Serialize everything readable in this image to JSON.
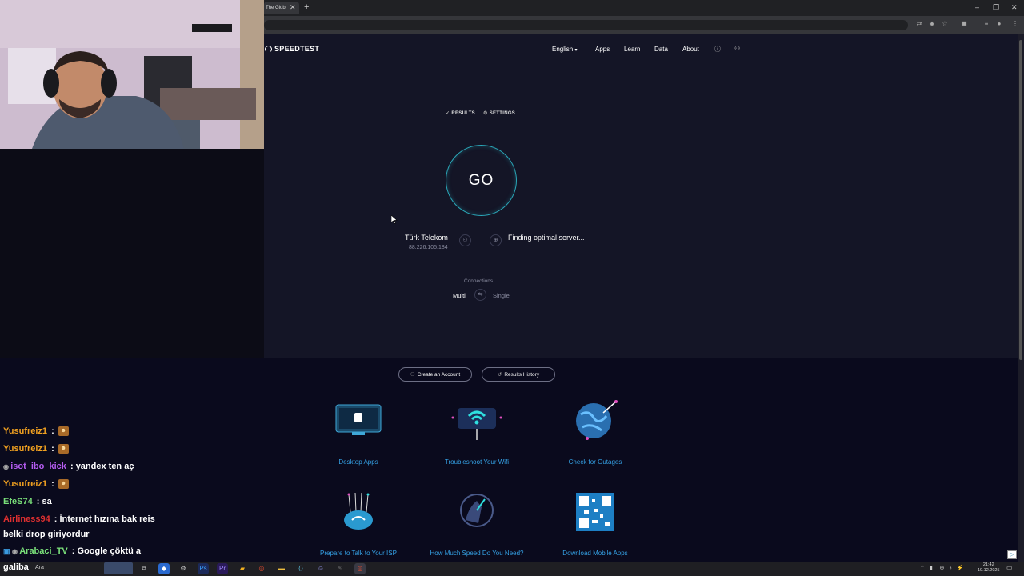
{
  "browser": {
    "tab_title": "The Glob",
    "new_tab": "+",
    "tab_close": "✕",
    "window_buttons": [
      "–",
      "❐",
      "✕"
    ]
  },
  "site": {
    "logo": "SPEEDTEST",
    "nav": {
      "language": "English",
      "apps": "Apps",
      "learn": "Learn",
      "data": "Data",
      "about": "About"
    }
  },
  "test": {
    "results_label": "RESULTS",
    "settings_label": "SETTINGS",
    "go_label": "GO",
    "isp_name": "Türk Telekom",
    "isp_ip": "88.226.105.184",
    "server_status": "Finding optimal server...",
    "connections_label": "Connections",
    "multi_label": "Multi",
    "single_label": "Single"
  },
  "actions": {
    "create_account": "Create an Account",
    "results_history": "Results History"
  },
  "cards": [
    {
      "label": "Desktop Apps"
    },
    {
      "label": "Troubleshoot Your Wifi"
    },
    {
      "label": "Check for Outages"
    },
    {
      "label": "Prepare to Talk to Your ISP"
    },
    {
      "label": "How Much Speed Do You Need?"
    },
    {
      "label": "Download Mobile Apps"
    }
  ],
  "chat": [
    {
      "user": "Yusufreiz1",
      "sep": " : ",
      "text": "",
      "color": "#f0a020"
    },
    {
      "user": "Yusufreiz1",
      "sep": " : ",
      "text": "",
      "color": "#f0a020"
    },
    {
      "user": "isot_ibo_kick",
      "sep": " : ",
      "text": "yandex ten aç",
      "color": "#b45cf0"
    },
    {
      "user": "Yusufreiz1",
      "sep": " : ",
      "text": "",
      "color": "#f0a020"
    },
    {
      "user": "EfeS74",
      "sep": " : ",
      "text": "sa",
      "color": "#7ae07a"
    },
    {
      "user": "Airliness94",
      "sep": " : ",
      "text": "İnternet hızına bak reis",
      "color": "#e03030"
    },
    {
      "user": "",
      "sep": "",
      "text": "belki drop giriyordur",
      "color": "#ffffff"
    },
    {
      "user": "Arabaci_TV",
      "sep": " : ",
      "text": "Google çöktü a",
      "color": "#7ae07a"
    },
    {
      "user": "",
      "sep": "",
      "text": "galiba",
      "color": "#ffffff"
    }
  ],
  "taskbar": {
    "search": "Ara",
    "time": "21:42",
    "date": "19.12.2025"
  },
  "colors": {
    "page_bg": "#141526",
    "lower_bg": "#0a0a1d",
    "accent": "#2aa7b8",
    "link": "#35a2e6"
  }
}
